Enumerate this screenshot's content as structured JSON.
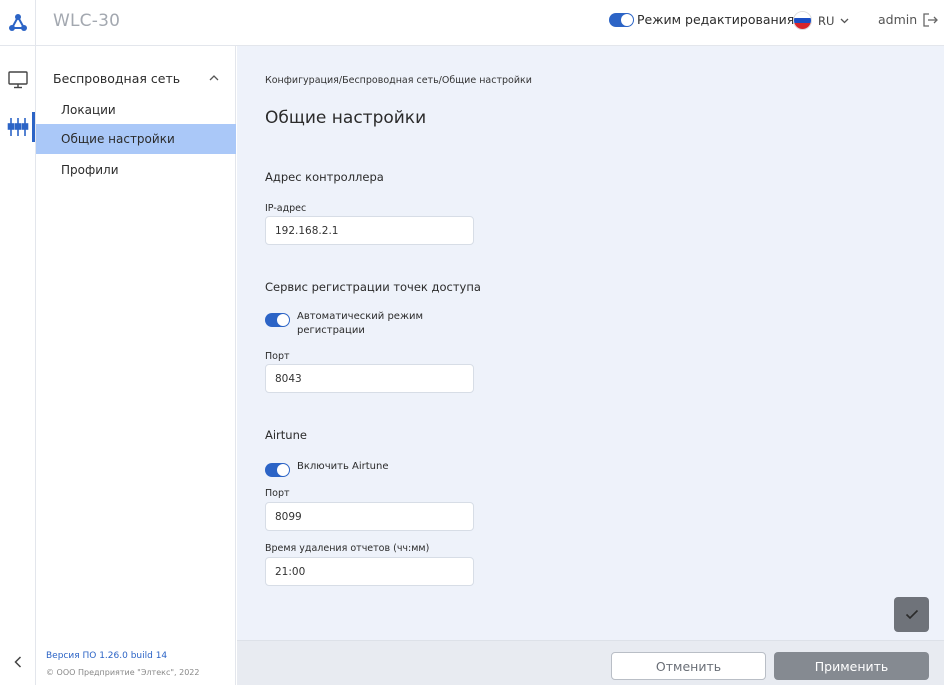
{
  "header": {
    "app_title": "WLC-30",
    "edit_mode_label": "Режим редактирования",
    "edit_mode_on": true,
    "language": "RU",
    "user": "admin"
  },
  "rail": {
    "items": [
      {
        "icon": "monitor-icon",
        "active": false
      },
      {
        "icon": "network-settings-icon",
        "active": true
      }
    ]
  },
  "sidebar": {
    "group_label": "Беспроводная сеть",
    "items": [
      {
        "label": "Локации",
        "active": false
      },
      {
        "label": "Общие настройки",
        "active": true
      },
      {
        "label": "Профили",
        "active": false
      }
    ],
    "version": "Версия ПО 1.26.0 build 14",
    "copyright": "© ООО Предприятие \"Элтекс\", 2022"
  },
  "main": {
    "breadcrumb": "Конфигурация/Беспроводная сеть/Общие настройки",
    "title": "Общие настройки",
    "controller": {
      "section_title": "Адрес контроллера",
      "ip_label": "IP-адрес",
      "ip_value": "192.168.2.1"
    },
    "registration": {
      "section_title": "Сервис регистрации точек доступа",
      "auto_label_line1": "Автоматический режим",
      "auto_label_line2": "регистрации",
      "auto_on": true,
      "port_label": "Порт",
      "port_value": "8043"
    },
    "airtune": {
      "section_title": "Airtune",
      "enable_label": "Включить Airtune",
      "enable_on": true,
      "port_label": "Порт",
      "port_value": "8099",
      "delete_time_label": "Время удаления отчетов (чч:мм)",
      "delete_time_value": "21:00"
    }
  },
  "footer": {
    "cancel_label": "Отменить",
    "apply_label": "Применить"
  },
  "colors": {
    "accent": "#2c64c6",
    "active_nav": "#aac8f8",
    "main_bg": "#eef2fa"
  }
}
